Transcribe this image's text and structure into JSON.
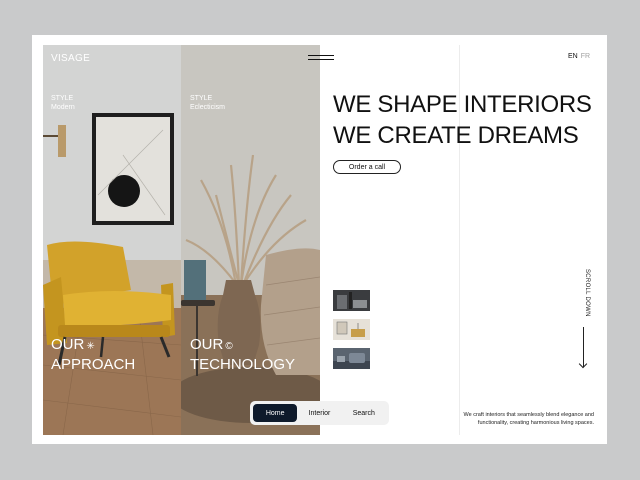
{
  "brand": "VISAGE",
  "panels": [
    {
      "style_title": "STYLE",
      "style_name": "Modern",
      "heading_line1": "OUR",
      "heading_mark": "✳",
      "heading_line2": "APPROACH"
    },
    {
      "style_title": "STYLE",
      "style_name": "Eclecticism",
      "heading_line1": "OUR",
      "heading_mark": "©",
      "heading_line2": "TECHNOLOGY"
    }
  ],
  "language": {
    "active": "EN",
    "inactive": "FR"
  },
  "hero": {
    "line1": "WE SHAPE INTERIORS",
    "line2": "WE CREATE DREAMS"
  },
  "cta": {
    "label": "Order a call"
  },
  "scroll": {
    "label": "SCROLL DOWN"
  },
  "tagline": "We craft interiors that seamlessly blend elegance and functionality, creating harmonious living spaces.",
  "nav": {
    "items": [
      "Home",
      "Interior",
      "Search"
    ],
    "active_index": 0
  },
  "colors": {
    "nav_active": "#0e1a2b",
    "chair": "#d4a52a",
    "background": "#c9cacb"
  }
}
